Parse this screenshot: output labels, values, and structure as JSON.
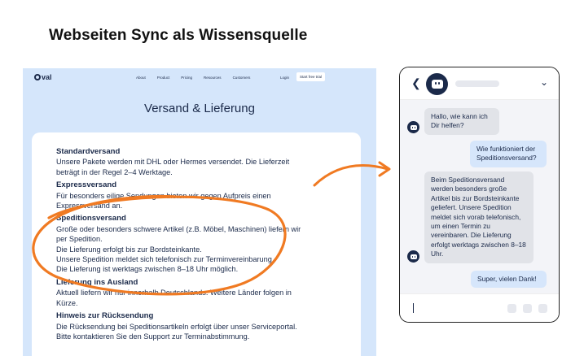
{
  "headline": "Webseiten Sync als Wissensquelle",
  "site": {
    "logo": "val",
    "nav": [
      "About",
      "Product",
      "Pricing",
      "Resources",
      "Customers"
    ],
    "login": "Login",
    "cta": "Start free trial",
    "title": "Versand & Lieferung",
    "sections": [
      {
        "heading": "Standardversand",
        "lines": [
          "Unsere Pakete werden mit DHL oder Hermes versendet. Die Lieferzeit",
          "beträgt in der Regel 2–4 Werktage."
        ]
      },
      {
        "heading": "Expressversand",
        "lines": [
          "Für besonders eilige Sendungen bieten wir gegen Aufpreis einen",
          "Expressversand an."
        ]
      },
      {
        "heading": "Speditionsversand",
        "lines": [
          "Große oder besonders schwere Artikel (z.B. Möbel, Maschinen) liefern wir",
          "per Spedition.",
          "Die Lieferung erfolgt bis zur Bordsteinkante.",
          "Unsere Spedition meldet sich telefonisch zur Terminvereinbarung.",
          "Die Lieferung ist werktags zwischen 8–18 Uhr möglich."
        ]
      },
      {
        "heading": "Lieferung ins Ausland",
        "lines": [
          "Aktuell liefern wir nur innerhalb Deutschlands. Weitere Länder folgen in",
          "Kürze."
        ]
      },
      {
        "heading": "Hinweis zur Rücksendung",
        "lines": [
          "Die Rücksendung bei Speditionsartikeln erfolgt über unser Serviceportal.",
          "Bitte kontaktieren Sie den Support zur Terminabstimmung."
        ]
      }
    ]
  },
  "chat": {
    "messages": [
      {
        "from": "bot",
        "text": "Hallo, wie kann ich Dir helfen?"
      },
      {
        "from": "user",
        "text": "Wie funktioniert der Speditionsversand?"
      },
      {
        "from": "bot",
        "text": "Beim Speditionsversand werden besonders große Artikel bis zur Bordsteinkante geliefert. Unsere Spedition meldet sich vorab telefonisch, um einen Termin zu vereinbaren. Die Lieferung erfolgt werktags zwischen 8–18 Uhr."
      },
      {
        "from": "user",
        "text": "Super, vielen Dank!"
      }
    ]
  },
  "colors": {
    "accent_orange": "#f07a22",
    "navy": "#1b2a4a",
    "site_bg": "#d5e6fb"
  },
  "icons": {
    "back": "chevron-left-icon",
    "menu": "chevron-down-icon",
    "bot": "bot-icon"
  }
}
